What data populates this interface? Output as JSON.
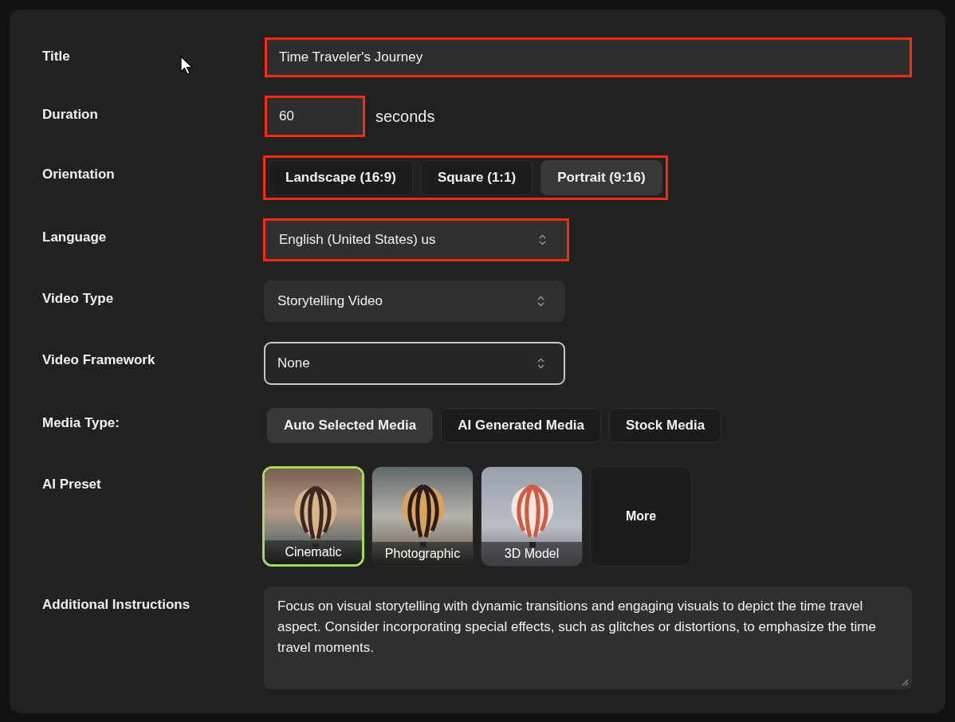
{
  "form": {
    "fields": [
      {
        "kind": "text",
        "label": "Title",
        "value": "Time Traveler's Journey",
        "highlighted": true
      },
      {
        "kind": "number",
        "label": "Duration",
        "value": "60",
        "unit": "seconds",
        "highlighted": true
      },
      {
        "kind": "segmented",
        "label": "Orientation",
        "highlighted": true,
        "options": [
          {
            "label": "Landscape (16:9)",
            "selected": false
          },
          {
            "label": "Square (1:1)",
            "selected": false
          },
          {
            "label": "Portrait (9:16)",
            "selected": true
          }
        ]
      },
      {
        "kind": "select",
        "label": "Language",
        "value": "English (United States) us",
        "highlighted": true,
        "focused": false
      },
      {
        "kind": "select",
        "label": "Video Type",
        "value": "Storytelling Video",
        "highlighted": false,
        "focused": false
      },
      {
        "kind": "select",
        "label": "Video Framework",
        "value": "None",
        "highlighted": false,
        "focused": true
      },
      {
        "kind": "segmented",
        "label": "Media Type:",
        "highlighted": false,
        "options": [
          {
            "label": "Auto Selected Media",
            "selected": true
          },
          {
            "label": "AI Generated Media",
            "selected": false
          },
          {
            "label": "Stock Media",
            "selected": false
          }
        ]
      },
      {
        "kind": "presets",
        "label": "AI Preset",
        "more": "More",
        "options": [
          {
            "label": "Cinematic",
            "selected": true
          },
          {
            "label": "Photographic",
            "selected": false
          },
          {
            "label": "3D Model",
            "selected": false
          }
        ]
      },
      {
        "kind": "textarea",
        "label": "Additional Instructions",
        "value": "Focus on visual storytelling with dynamic transitions and engaging visuals to depict the time travel aspect.  Consider incorporating special effects, such as glitches or distortions, to emphasize the time travel moments."
      }
    ]
  }
}
